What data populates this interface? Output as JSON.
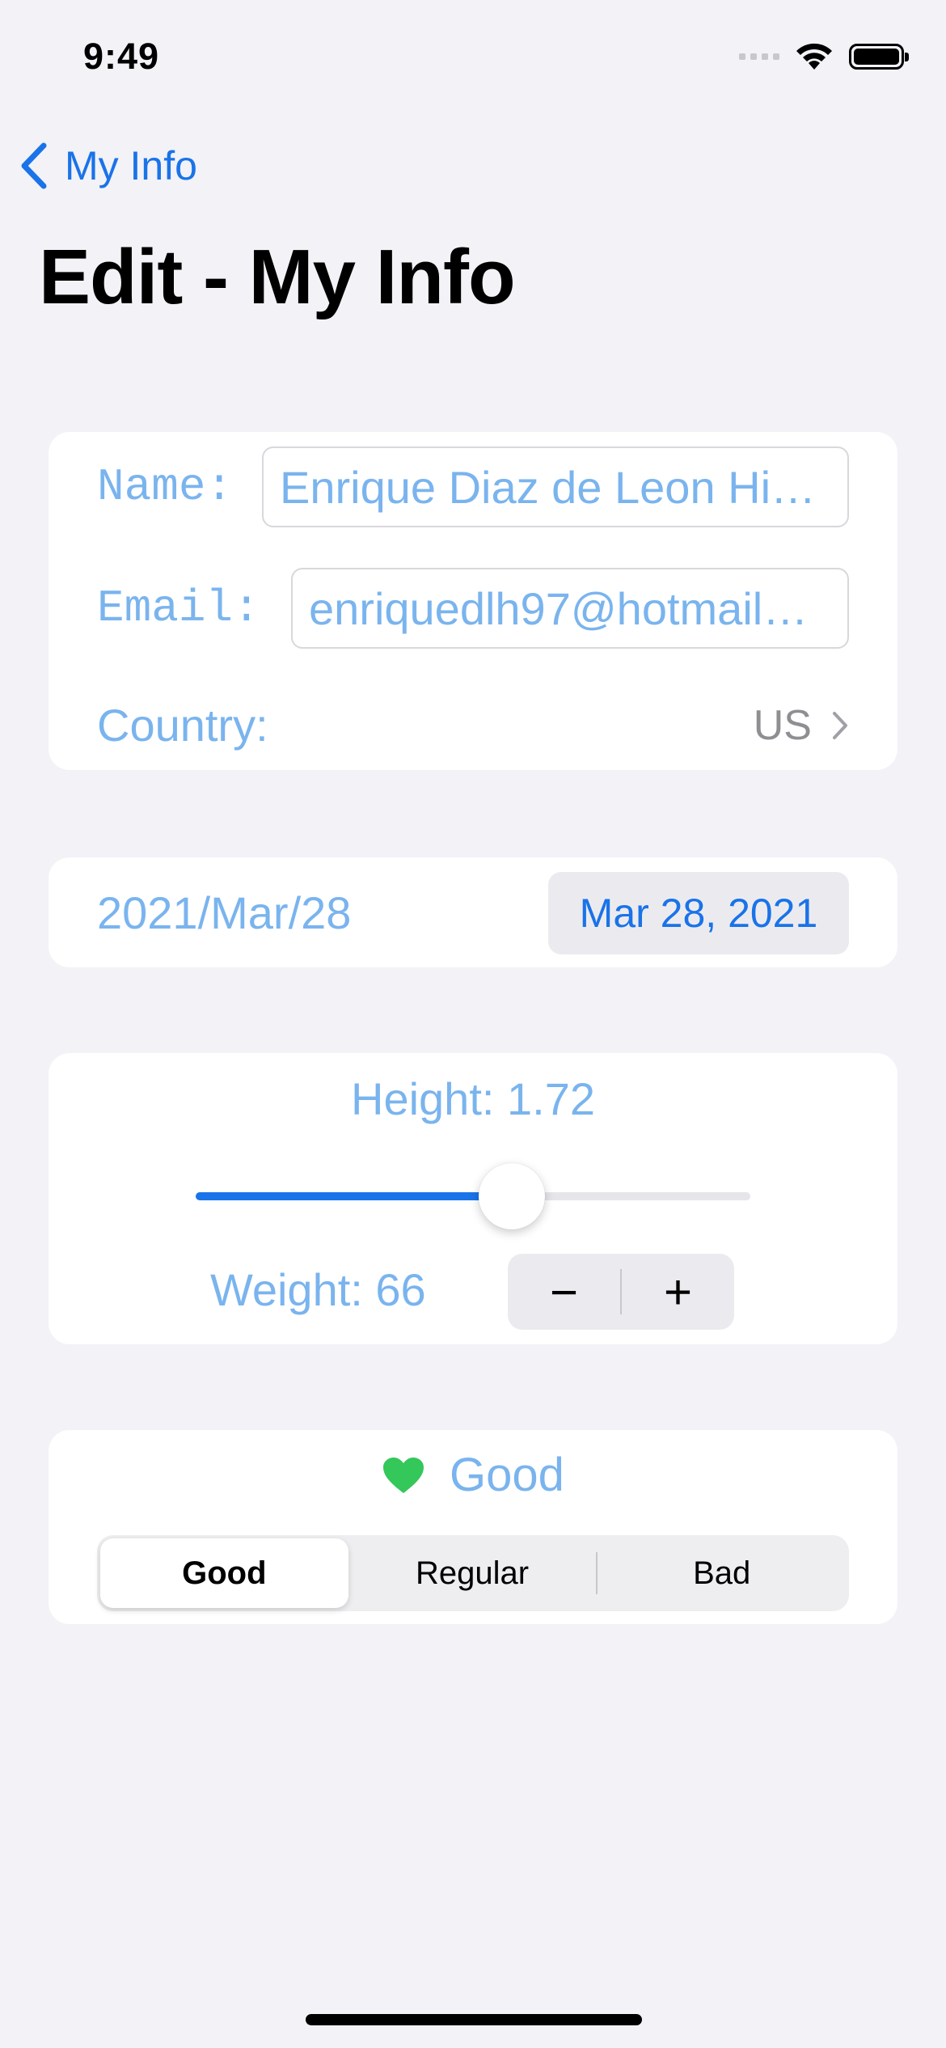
{
  "status_bar": {
    "time": "9:49"
  },
  "nav": {
    "back_label": "My Info",
    "title": "Edit - My Info"
  },
  "profile": {
    "name_label": "Name:",
    "name_value": "Enrique Diaz de Leon Hi…",
    "email_label": "Email:",
    "email_value": "enriquedlh97@hotmail…",
    "country_label": "Country:",
    "country_value": "US"
  },
  "date": {
    "formatted": "2021/Mar/28",
    "picker_value": "Mar 28, 2021"
  },
  "measurements": {
    "height_text": "Height: 1.72",
    "height_slider_fraction": 0.57,
    "weight_text": "Weight: 66",
    "stepper_minus": "−",
    "stepper_plus": "+"
  },
  "mood": {
    "current": "Good",
    "icon": "heart-icon",
    "icon_color": "#34c759",
    "options": [
      "Good",
      "Regular",
      "Bad"
    ],
    "selected_index": 0
  },
  "colors": {
    "accent": "#1a73e8",
    "label": "#7ab4ee",
    "background": "#f2f2f7"
  }
}
